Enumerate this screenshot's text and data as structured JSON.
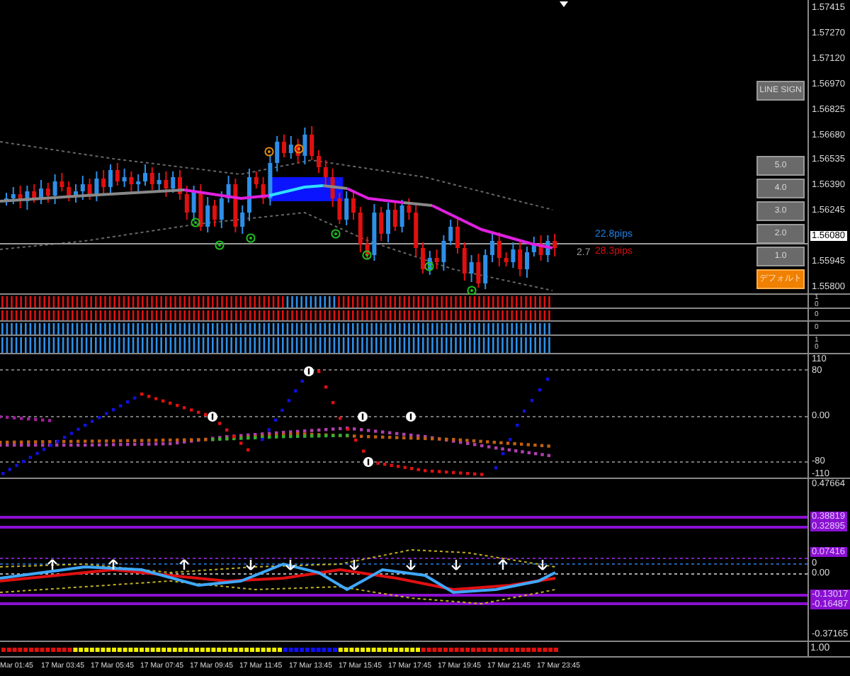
{
  "main_chart": {
    "price_axis": [
      {
        "text": "1.57415",
        "kind": "tick"
      },
      {
        "text": "1.57270",
        "kind": "tick"
      },
      {
        "text": "1.57120",
        "kind": "tick"
      },
      {
        "text": "1.56970",
        "kind": "tick"
      },
      {
        "text": "1.56825",
        "kind": "tick"
      },
      {
        "text": "1.56680",
        "kind": "tick"
      },
      {
        "text": "1.56535",
        "kind": "tick"
      },
      {
        "text": "1.56390",
        "kind": "tick"
      },
      {
        "text": "1.56245",
        "kind": "tick"
      },
      {
        "text": "1.56080",
        "kind": "current"
      },
      {
        "text": "1.55945",
        "kind": "tick"
      },
      {
        "text": "1.55800",
        "kind": "tick"
      }
    ],
    "buttons": [
      {
        "label": "LINE SIGN",
        "kind": "normal"
      },
      {
        "label": "5.0",
        "kind": "normal"
      },
      {
        "label": "4.0",
        "kind": "normal"
      },
      {
        "label": "3.0",
        "kind": "normal"
      },
      {
        "label": "2.0",
        "kind": "normal"
      },
      {
        "label": "1.0",
        "kind": "normal"
      },
      {
        "label": "デフォルト",
        "kind": "default"
      }
    ],
    "readouts": [
      {
        "text": "22.8pips",
        "kind": "up"
      },
      {
        "text": "2.7",
        "kind": "spread"
      },
      {
        "text": "28.3pips",
        "kind": "down"
      }
    ]
  },
  "signal_strips": [
    {
      "axis": [
        "1",
        "0"
      ]
    },
    {
      "axis": [
        "0"
      ]
    },
    {
      "axis": [
        "0"
      ]
    },
    {
      "axis": [
        "1",
        "0"
      ]
    }
  ],
  "oscillator": {
    "axis": [
      "110",
      "80",
      "0.00",
      "-80",
      "-110"
    ]
  },
  "lower_indicator": {
    "axis": [
      {
        "text": "0.47664",
        "kind": "tick"
      },
      {
        "text": "0.38819",
        "kind": "level"
      },
      {
        "text": "0.32895",
        "kind": "level"
      },
      {
        "text": "0.07416",
        "kind": "level"
      },
      {
        "text": "0",
        "kind": "tick"
      },
      {
        "text": "0.00",
        "kind": "tick"
      },
      {
        "text": "-0.13017",
        "kind": "level"
      },
      {
        "text": "-0.16487",
        "kind": "level"
      },
      {
        "text": "-0.37165",
        "kind": "tick"
      }
    ]
  },
  "bottom_strip": {
    "axis": "1.00"
  },
  "time_axis": [
    "Mar 01:45",
    "17 Mar 03:45",
    "17 Mar 05:45",
    "17 Mar 07:45",
    "17 Mar 09:45",
    "17 Mar 11:45",
    "17 Mar 13:45",
    "17 Mar 15:45",
    "17 Mar 17:45",
    "17 Mar 19:45",
    "17 Mar 21:45",
    "17 Mar 23:45"
  ]
}
